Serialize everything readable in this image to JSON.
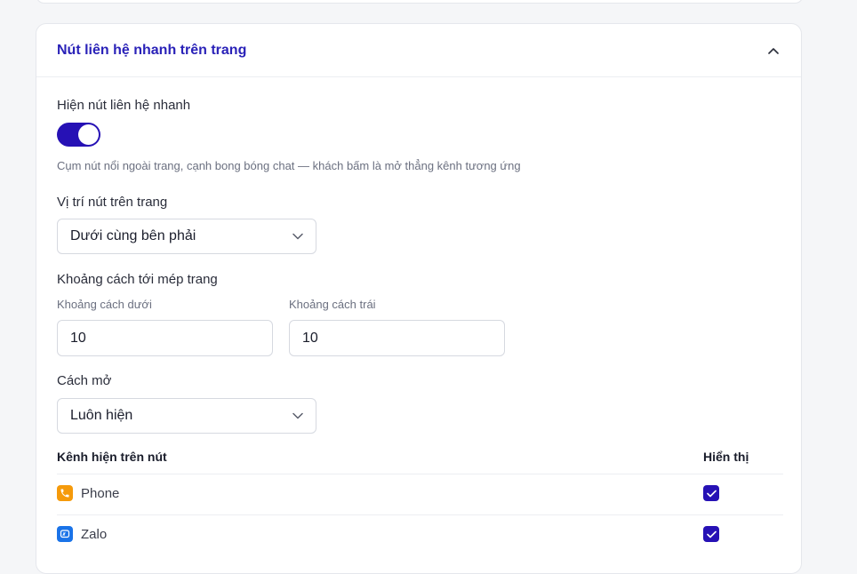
{
  "section": {
    "title": "Nút liên hệ nhanh trên trang",
    "collapse_icon": "chevron-up-icon"
  },
  "quick_contact": {
    "toggle_label": "Hiện nút liên hệ nhanh",
    "toggle_on": true,
    "hint": "Cụm nút nổi ngoài trang, cạnh bong bóng chat — khách bấm là mở thẳng kênh tương ứng"
  },
  "position": {
    "label": "Vị trí nút trên trang",
    "selected": "Dưới cùng bên phải"
  },
  "offset": {
    "label": "Khoảng cách tới mép trang",
    "bottom_label": "Khoảng cách dưới",
    "bottom_value": "10",
    "left_label": "Khoảng cách trái",
    "left_value": "10"
  },
  "open_mode": {
    "label": "Cách mở",
    "selected": "Luôn hiện"
  },
  "channels": {
    "col_channel": "Kênh hiện trên nút",
    "col_visible": "Hiển thị",
    "rows": [
      {
        "name": "Phone",
        "icon": "phone-icon",
        "color": "#f59a0b",
        "visible": true
      },
      {
        "name": "Zalo",
        "icon": "zalo-icon",
        "color": "#1a73e8",
        "visible": true
      }
    ]
  },
  "colors": {
    "accent": "#2611b5",
    "title": "#2a22b8"
  }
}
